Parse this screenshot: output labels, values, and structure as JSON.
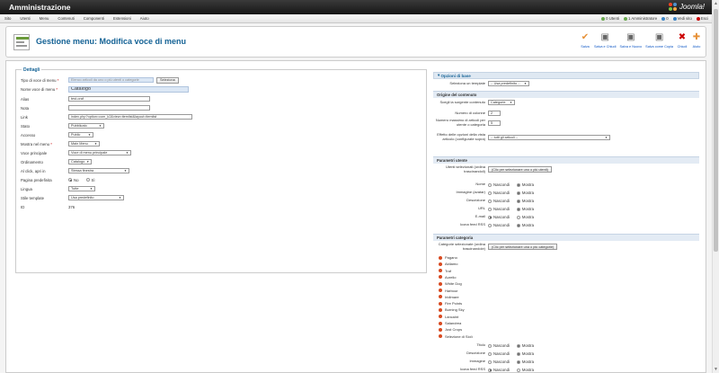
{
  "topbar": {
    "title": "Amministrazione",
    "logo": "Joomla!"
  },
  "menu": [
    "Sito",
    "Utenti",
    "Menu",
    "Contenuti",
    "Componenti",
    "Estensioni",
    "Aiuto"
  ],
  "status": [
    {
      "label": "0 Utenti",
      "color": "#6aa84f"
    },
    {
      "label": "1 Amministratore",
      "color": "#6aa84f"
    },
    {
      "label": "0",
      "color": "#3d85c6"
    },
    {
      "label": "Vedi sito",
      "color": "#3d85c6"
    },
    {
      "label": "Esci",
      "color": "#cc0000"
    }
  ],
  "page_title": "Gestione menu: Modifica voce di menu",
  "toolbar": [
    {
      "label": "Salva",
      "icon": "✔",
      "color": "#e69138",
      "name": "save-button"
    },
    {
      "label": "Salva e Chiudi",
      "icon": "▣",
      "color": "#666666",
      "name": "save-close-button"
    },
    {
      "label": "Salva e Nuovo",
      "icon": "▣",
      "color": "#666666",
      "name": "save-new-button"
    },
    {
      "label": "Salva come Copia",
      "icon": "▣",
      "color": "#666666",
      "name": "save-copy-button"
    },
    {
      "label": "Chiudi",
      "icon": "✖",
      "color": "#cc0000",
      "name": "close-button"
    },
    {
      "label": "Aiuto",
      "icon": "✚",
      "color": "#e69138",
      "name": "help-button"
    }
  ],
  "details": {
    "legend": "Dettagli",
    "tipo_label": "Tipo di voce di menu",
    "tipo_value": "Elenco articoli da uno o più utenti o categorie",
    "tipo_button": "Seleziona",
    "nome_label": "Nome voce di menu",
    "nome_value": "Catalogo",
    "alias_label": "Alias",
    "alias_value": "test-oraf",
    "nota_label": "Nota",
    "nota_value": "",
    "link_label": "Link",
    "link_value": "index.php?option=com_k2&view=itemlist&layout=itemlist",
    "stato_label": "Stato",
    "stato_value": "Pubblicato",
    "accesso_label": "Accesso",
    "accesso_value": "Public",
    "mostra_label": "Mostra nel menu",
    "mostra_value": "Main Menu",
    "voce_label": "Voce principale",
    "voce_value": "Voce di menu principale",
    "ordinamento_label": "Ordinamento",
    "ordinamento_value": "Catalogo",
    "click_label": "Al click, apri in",
    "click_value": "Stessa finestra",
    "pagina_label": "Pagina predefinita",
    "pagina_no": "No",
    "pagina_si": "Sì",
    "lingua_label": "Lingua",
    "lingua_value": "Tutte",
    "stile_label": "Stile template",
    "stile_value": "Usa predefinito",
    "id_label": "ID",
    "id_value": "376"
  },
  "right": {
    "opzioni_head": "Opzioni di base",
    "seleziona_template_label": "Seleziona un template",
    "seleziona_template_value": "-- Usa predefinito --",
    "origine_head": "Origine del contenuto",
    "scegli_label": "Scegli la sorgente contenuto",
    "scegli_value": "Categorie",
    "colonne_label": "Numero di colonne",
    "colonne_value": "2",
    "max_label": "Numero massimo di articoli per utente o categoria",
    "max_value": "5",
    "effetto_label": "Effetto delle opzioni della vista articolo (configurate sopra)",
    "effetto_value": "-- tutti gli articoli --",
    "utente_head": "Parametri utente",
    "utenti_sel_label": "Utenti selezionati (ordina trascinandoli)",
    "utenti_sel_button": "(Clic per selezionare uno o più utenti)",
    "user_params": [
      {
        "label": "Nome",
        "value": "Mostra"
      },
      {
        "label": "Immagine (avatar)",
        "value": "Mostra"
      },
      {
        "label": "Descrizione",
        "value": "Mostra"
      },
      {
        "label": "URL",
        "value": "Mostra"
      },
      {
        "label": "E-mail",
        "value": "Nascondi"
      },
      {
        "label": "Icona feed RSS",
        "value": "Mostra"
      }
    ],
    "cat_head": "Parametri categoria",
    "cat_sel_label": "Categorie selezionate (ordina trascinandole)",
    "cat_sel_button": "(Clic per selezionare una o più categorie)",
    "categories": [
      "Pagano",
      "Aldiamo",
      "Traf",
      "Aurelio",
      "White Dog",
      "Harbour",
      "Iridimare",
      "Fire Points",
      "Burning Sky",
      "Lancaint",
      "Salandrea",
      "Just Crops",
      "Selezione di Siolì"
    ],
    "cat_params": [
      {
        "label": "Titolo",
        "value": "Mostra"
      },
      {
        "label": "Descrizione",
        "value": "Mostra"
      },
      {
        "label": "Immagine",
        "value": "Mostra"
      },
      {
        "label": "Icona feed RSS",
        "value": "Nascondi"
      }
    ],
    "opt_hide": "Nascondi",
    "opt_show": "Mostra"
  }
}
